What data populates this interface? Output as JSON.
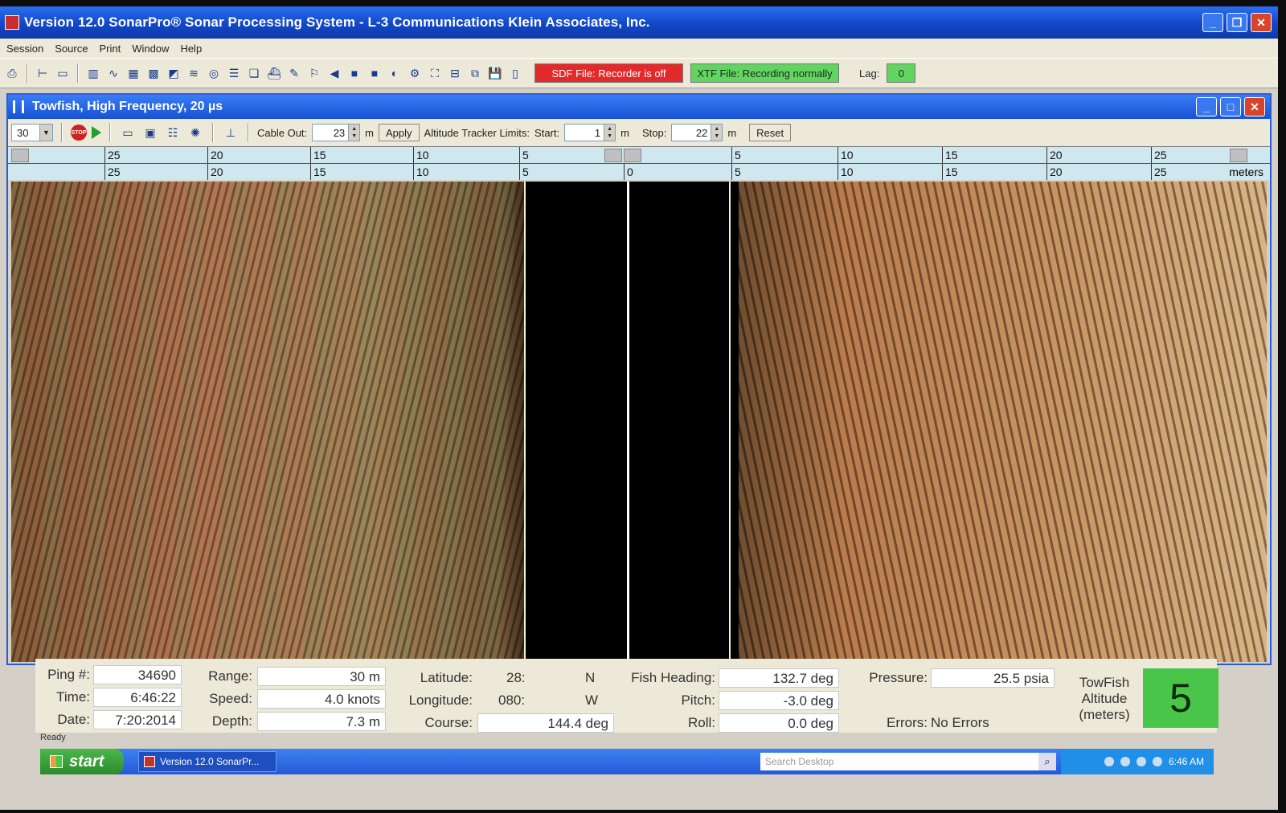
{
  "window": {
    "title": "Version 12.0 SonarPro® Sonar Processing System - L-3 Communications Klein Associates, Inc."
  },
  "menu": [
    "Session",
    "Source",
    "Print",
    "Window",
    "Help"
  ],
  "toolbar": {
    "sdf_status": "SDF File: Recorder is off",
    "xtf_status": "XTF File: Recording normally",
    "lag_label": "Lag:",
    "lag_value": "0",
    "colors": {
      "sdf": "#e32a2a",
      "xtf": "#62d462"
    }
  },
  "child": {
    "title": "Towfish, High Frequency, 20 µs",
    "range_select": "30",
    "cable_out_label": "Cable Out:",
    "cable_out_value": "23",
    "unit_m": "m",
    "apply_label": "Apply",
    "altitude_limits_label": "Altitude Tracker Limits:",
    "start_label": "Start:",
    "start_value": "1",
    "stop_label": "Stop:",
    "stop_value": "22",
    "reset_label": "Reset"
  },
  "ruler": {
    "top_ticks": [
      "25",
      "20",
      "15",
      "10",
      "5",
      "5",
      "10",
      "15",
      "20",
      "25"
    ],
    "bottom_ticks": [
      "25",
      "20",
      "15",
      "10",
      "5",
      "0",
      "5",
      "10",
      "15",
      "20",
      "25"
    ],
    "unit": "meters"
  },
  "info": {
    "ping_label": "Ping #:",
    "ping": "34690",
    "time_label": "Time:",
    "time": "6:46:22",
    "date_label": "Date:",
    "date": "7:20:2014",
    "range_label": "Range:",
    "range": "30 m",
    "speed_label": "Speed:",
    "speed": "4.0 knots",
    "depth_label": "Depth:",
    "depth": "7.3 m",
    "latitude_label": "Latitude:",
    "latitude": "28:",
    "lat_hemi": "N",
    "longitude_label": "Longitude:",
    "longitude": "080:",
    "lon_hemi": "W",
    "course_label": "Course:",
    "course": "144.4 deg",
    "heading_label": "Fish Heading:",
    "heading": "132.7 deg",
    "pitch_label": "Pitch:",
    "pitch": "-3.0 deg",
    "roll_label": "Roll:",
    "roll": "0.0 deg",
    "pressure_label": "Pressure:",
    "pressure": "25.5 psia",
    "errors_label": "Errors:",
    "errors": "No Errors",
    "altitude_label": "TowFish Altitude (meters)",
    "altitude": "5"
  },
  "status_bar": {
    "text": "Ready"
  },
  "taskbar": {
    "start": "start",
    "task": "Version 12.0 SonarPr...",
    "search_placeholder": "Search Desktop",
    "clock": "6:46 AM"
  }
}
